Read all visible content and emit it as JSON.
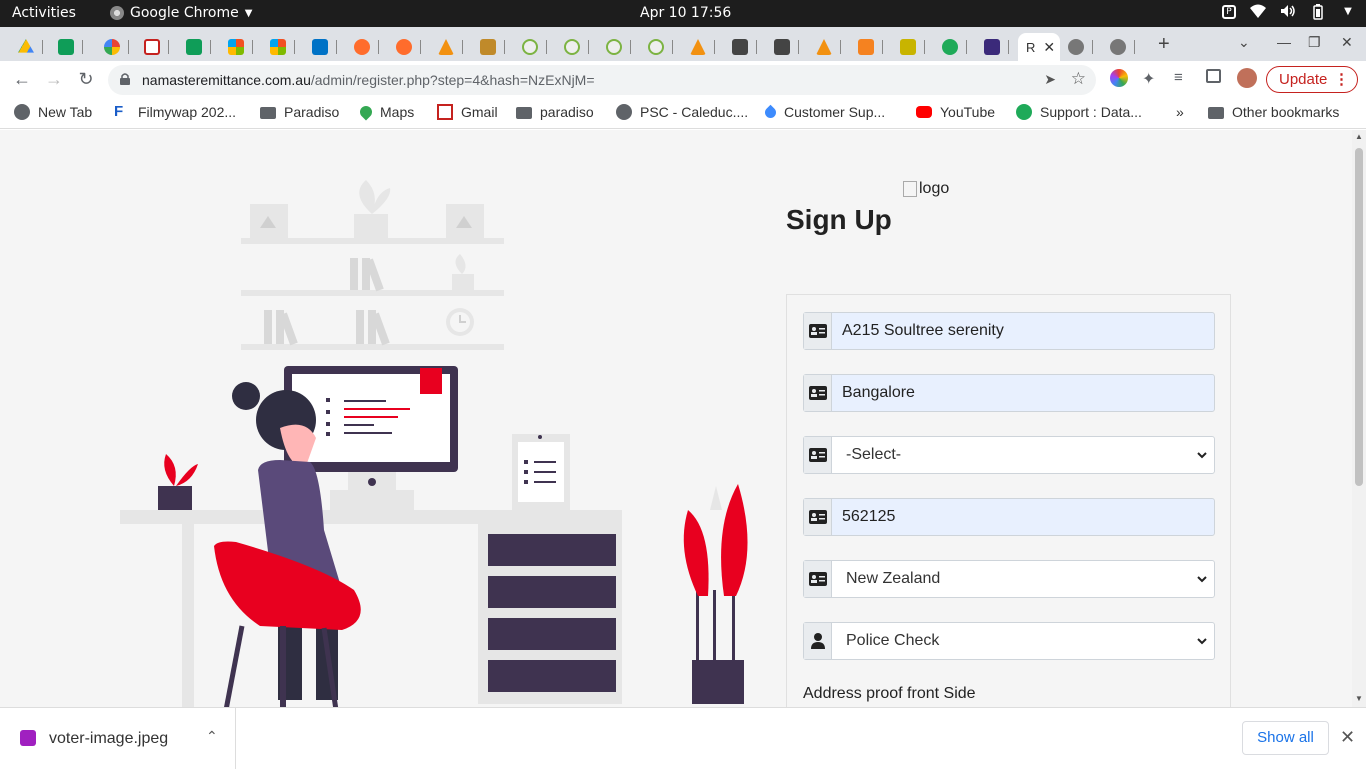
{
  "system": {
    "activities": "Activities",
    "app_name": "Google Chrome",
    "clock": "Apr 10  17:56"
  },
  "tabs": {
    "active_label": "R",
    "active_close": "✕",
    "new_tab": "+"
  },
  "address": {
    "domain": "namasteremittance.com.au",
    "path": "/admin/register.php?step=4&hash=NzExNjM="
  },
  "toolbar": {
    "update_label": "Update",
    "more": "⋮"
  },
  "bookmarks": {
    "items": [
      "New Tab",
      "Filmywap 202...",
      "Paradiso",
      "Maps",
      "Gmail",
      "paradiso",
      "PSC - Caleduc....",
      "Customer Sup...",
      "YouTube",
      "Support : Data..."
    ],
    "overflow": "»",
    "other": "Other bookmarks"
  },
  "page": {
    "logo_alt": "logo",
    "title": "Sign Up",
    "fields": {
      "address": "A215 Soultree serenity",
      "city": "Bangalore",
      "state": "-Select-",
      "postcode": "562125",
      "country": "New Zealand",
      "document_type": "Police Check"
    },
    "address_proof_label": "Address proof front Side"
  },
  "downloads": {
    "file_name": "voter-image.jpeg",
    "show_all": "Show all"
  },
  "colors": {
    "accent_red": "#e8001f",
    "illustration_purple": "#3f3350",
    "field_autofill_bg": "#e8f0fe"
  }
}
